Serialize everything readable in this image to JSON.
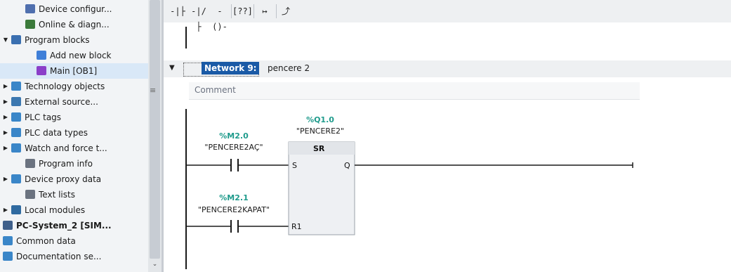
{
  "project_tree": {
    "items": [
      {
        "label": "Device configur...",
        "icon": "device-config-icon",
        "expander": "",
        "color": "#4f6fae"
      },
      {
        "label": "Online & diagn...",
        "icon": "online-diagnostics-icon",
        "expander": "",
        "color": "#3b7a3b"
      },
      {
        "label": "Program blocks",
        "icon": "program-blocks-folder-icon",
        "expander": "▼",
        "color": "#3a6fb0"
      },
      {
        "label": "Add new block",
        "icon": "add-block-icon",
        "expander": "",
        "color": "#3f7fd8"
      },
      {
        "label": "Main [OB1]",
        "icon": "ob-block-icon",
        "expander": "",
        "color": "#8b3fc9"
      },
      {
        "label": "Technology objects",
        "icon": "technology-objects-icon",
        "expander": "▶",
        "color": "#3a86c8"
      },
      {
        "label": "External source...",
        "icon": "external-source-icon",
        "expander": "▶",
        "color": "#3c78b0"
      },
      {
        "label": "PLC tags",
        "icon": "plc-tags-icon",
        "expander": "▶",
        "color": "#3a86c8"
      },
      {
        "label": "PLC data types",
        "icon": "plc-data-types-icon",
        "expander": "▶",
        "color": "#3a86c8"
      },
      {
        "label": "Watch and force t...",
        "icon": "watch-force-icon",
        "expander": "▶",
        "color": "#3a86c8"
      },
      {
        "label": "Program info",
        "icon": "program-info-icon",
        "expander": "",
        "color": "#6b7380"
      },
      {
        "label": "Device proxy data",
        "icon": "device-proxy-icon",
        "expander": "▶",
        "color": "#3a86c8"
      },
      {
        "label": "Text lists",
        "icon": "text-lists-icon",
        "expander": "",
        "color": "#6b7380"
      },
      {
        "label": "Local modules",
        "icon": "local-modules-icon",
        "expander": "▶",
        "color": "#2f6aa0"
      },
      {
        "label": "PC-System_2 [SIM...",
        "icon": "pc-system-icon",
        "expander": "▶",
        "color": "#3e5f8a"
      },
      {
        "label": "Common data",
        "icon": "common-data-icon",
        "expander": "▶",
        "color": "#3a86c8"
      },
      {
        "label": "Documentation se...",
        "icon": "documentation-icon",
        "expander": "▶",
        "color": "#3a86c8"
      }
    ]
  },
  "toolbar": {
    "buttons": [
      {
        "name": "no-contact-button",
        "glyph": "-|├"
      },
      {
        "name": "nc-contact-button",
        "glyph": "-|/├"
      },
      {
        "name": "coil-button",
        "glyph": "-()-"
      },
      {
        "name": "empty-box-button",
        "glyph": "[??]"
      },
      {
        "name": "open-branch-button",
        "glyph": "↦"
      },
      {
        "name": "close-branch-button",
        "glyph": "⤴"
      }
    ]
  },
  "network": {
    "title": "Network 9:",
    "name": "pencere 2",
    "comment_placeholder": "Comment"
  },
  "ladder": {
    "contact1": {
      "address": "%M2.0",
      "symbol": "\"PENCERE2AÇ\""
    },
    "contact2": {
      "address": "%M2.1",
      "symbol": "\"PENCERE2KAPAT\""
    },
    "sr_block": {
      "address": "%Q1.0",
      "symbol": "\"PENCERE2\"",
      "type": "SR",
      "pin_s": "S",
      "pin_q": "Q",
      "pin_r1": "R1"
    }
  },
  "colors": {
    "accent": "#1a5aa6",
    "operand_address": "#1f9b8c",
    "tree_bg": "#f2f4f6",
    "selected_row": "#d9e8f7"
  }
}
